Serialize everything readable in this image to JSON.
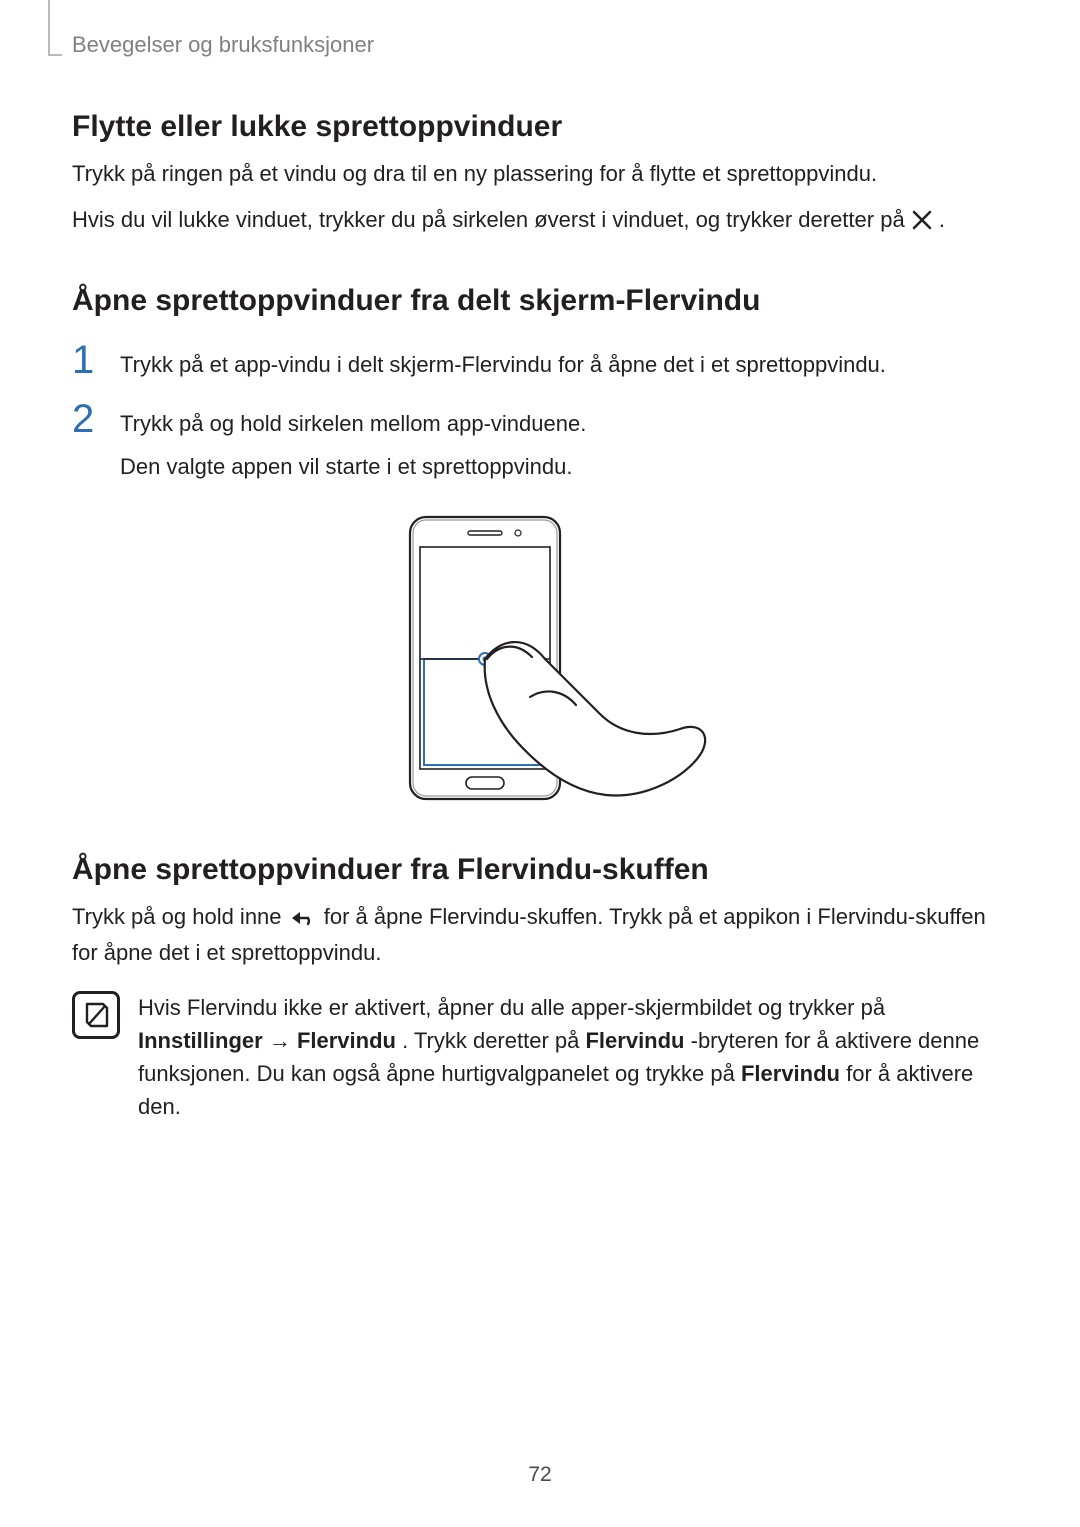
{
  "running_head": "Bevegelser og bruksfunksjoner",
  "h1_move_close": "Flytte eller lukke sprettoppvinduer",
  "move_close_p1": "Trykk på ringen på et vindu og dra til en ny plassering for å flytte et sprettoppvindu.",
  "move_close_p2a": "Hvis du vil lukke vinduet, trykker du på sirkelen øverst i vinduet, og trykker deretter på ",
  "move_close_p2b": ".",
  "h1_open_split": "Åpne sprettoppvinduer fra delt skjerm-Flervindu",
  "step1_num": "1",
  "step1_text": "Trykk på et app-vindu i delt skjerm-Flervindu for å åpne det i et sprettoppvindu.",
  "step2_num": "2",
  "step2_text": "Trykk på og hold sirkelen mellom app-vinduene.",
  "step2_sub": "Den valgte appen vil starte i et sprettoppvindu.",
  "h1_open_tray": "Åpne sprettoppvinduer fra Flervindu-skuffen",
  "tray_p_a": "Trykk på og hold inne ",
  "tray_p_b": " for å åpne Flervindu-skuffen. Trykk på et appikon i Flervindu-skuffen for åpne det i et sprettoppvindu.",
  "note_a": "Hvis Flervindu ikke er aktivert, åpner du alle apper-skjermbildet og trykker på ",
  "note_b": "Innstillinger",
  "note_arrow": " → ",
  "note_c": "Flervindu",
  "note_d": ". Trykk deretter på ",
  "note_e": "Flervindu",
  "note_f": "-bryteren for å aktivere denne funksjonen. Du kan også åpne hurtigvalgpanelet og trykke på ",
  "note_g": "Flervindu",
  "note_h": " for å aktivere den.",
  "page_number": "72"
}
